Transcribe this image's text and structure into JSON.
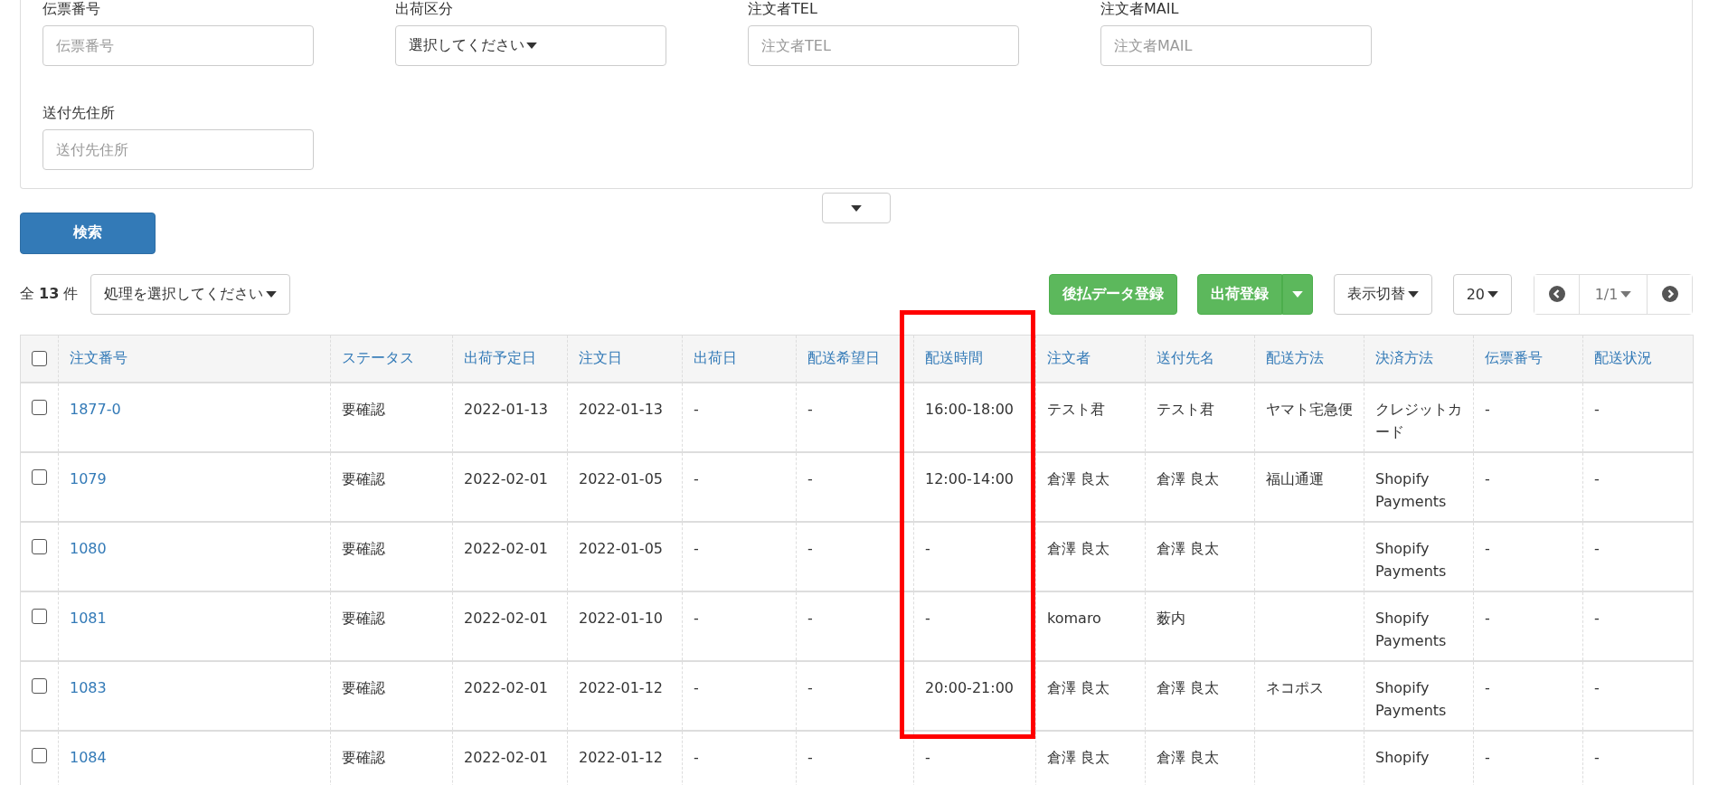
{
  "filters": [
    {
      "kind": "input",
      "label": "伝票番号",
      "placeholder": "伝票番号"
    },
    {
      "kind": "select",
      "label": "出荷区分",
      "value": "選択してください"
    },
    {
      "kind": "input",
      "label": "注文者TEL",
      "placeholder": "注文者TEL"
    },
    {
      "kind": "input",
      "label": "注文者MAIL",
      "placeholder": "注文者MAIL"
    },
    {
      "kind": "input",
      "label": "送付先住所",
      "placeholder": "送付先住所"
    }
  ],
  "search_button": "検索",
  "total": {
    "prefix": "全",
    "count": "13",
    "suffix": "件"
  },
  "bulk_action": "処理を選択してください",
  "toolbar_buttons": [
    {
      "kind": "green",
      "label": "後払データ登録"
    },
    {
      "kind": "split",
      "label": "出荷登録"
    },
    {
      "kind": "dropdown",
      "label": "表示切替"
    },
    {
      "kind": "dropdown",
      "label": "20"
    }
  ],
  "pager": {
    "page": "1/1"
  },
  "table": {
    "select_all_checked": false,
    "columns": [
      "注文番号",
      "ステータス",
      "出荷予定日",
      "注文日",
      "出荷日",
      "配送希望日",
      "配送時間",
      "注文者",
      "送付先名",
      "配送方法",
      "決済方法",
      "伝票番号",
      "配送状況"
    ],
    "rows": [
      {
        "checked": false,
        "cells": [
          "1877-0",
          "要確認",
          "2022-01-13",
          "2022-01-13",
          "-",
          "-",
          "16:00-18:00",
          "テスト君",
          "テスト君",
          "ヤマト宅急便",
          "クレジットカード",
          "-",
          "-"
        ]
      },
      {
        "checked": false,
        "cells": [
          "1079",
          "要確認",
          "2022-02-01",
          "2022-01-05",
          "-",
          "-",
          "12:00-14:00",
          "倉澤 良太",
          "倉澤 良太",
          "福山通運",
          "Shopify Payments",
          "-",
          "-"
        ]
      },
      {
        "checked": false,
        "cells": [
          "1080",
          "要確認",
          "2022-02-01",
          "2022-01-05",
          "-",
          "-",
          "-",
          "倉澤 良太",
          "倉澤 良太",
          "",
          "Shopify Payments",
          "-",
          "-"
        ]
      },
      {
        "checked": false,
        "cells": [
          "1081",
          "要確認",
          "2022-02-01",
          "2022-01-10",
          "-",
          "-",
          "-",
          "komaro",
          "薮内",
          "",
          "Shopify Payments",
          "-",
          "-"
        ]
      },
      {
        "checked": false,
        "cells": [
          "1083",
          "要確認",
          "2022-02-01",
          "2022-01-12",
          "-",
          "-",
          "20:00-21:00",
          "倉澤 良太",
          "倉澤 良太",
          "ネコポス",
          "Shopify Payments",
          "-",
          "-"
        ]
      },
      {
        "checked": false,
        "cells": [
          "1084",
          "要確認",
          "2022-02-01",
          "2022-01-12",
          "-",
          "-",
          "-",
          "倉澤 良太",
          "倉澤 良太",
          "",
          "Shopify",
          "-",
          "-"
        ]
      }
    ]
  }
}
